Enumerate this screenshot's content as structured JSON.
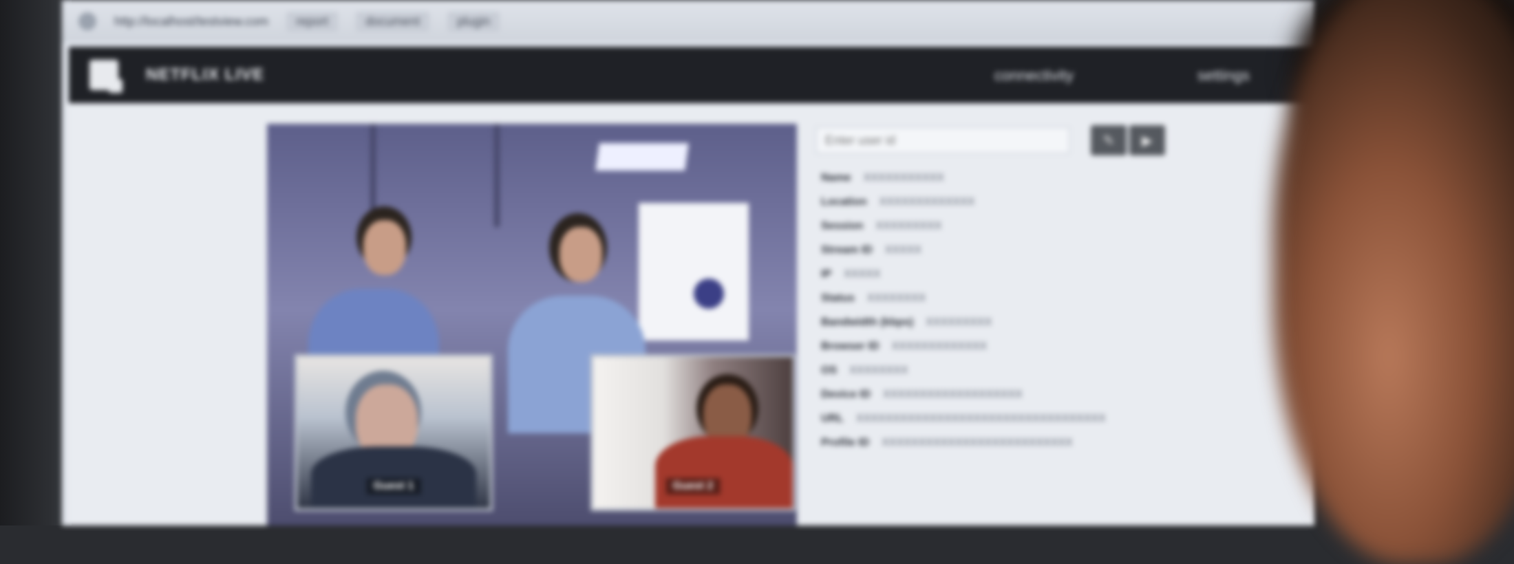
{
  "browser": {
    "url": "http://localhost/testview.com",
    "tabs": [
      "report",
      "document",
      "plugin"
    ]
  },
  "header": {
    "title": "NETFLIX LIVE",
    "links": [
      "connectivity",
      "settings"
    ]
  },
  "video": {
    "pip_labels": [
      "Guest 1",
      "Guest 2"
    ]
  },
  "panel": {
    "search_placeholder": "Enter user id",
    "buttons": [
      "edit-icon",
      "play-icon"
    ],
    "meta": [
      {
        "key": "Name",
        "value": "XXXXXXXXXXX"
      },
      {
        "key": "Location",
        "value": "XXXXXXXXXXXXX"
      },
      {
        "key": "Session",
        "value": "XXXXXXXXX"
      },
      {
        "key": "Stream ID",
        "value": "XXXXX"
      },
      {
        "key": "IP",
        "value": "XXXXX"
      },
      {
        "key": "Status",
        "value": "XXXXXXXX"
      },
      {
        "key": "Bandwidth (kbps)",
        "value": "XXXXXXXXX"
      },
      {
        "key": "Browser ID",
        "value": "XXXXXXXXXXXXX"
      },
      {
        "key": "OS",
        "value": "XXXXXXXX"
      },
      {
        "key": "Device ID",
        "value": "XXXXXXXXXXXXXXXXXXX"
      },
      {
        "key": "URL",
        "value": "XXXXXXXXXXXXXXXXXXXXXXXXXXXXXXXXXX"
      },
      {
        "key": "Profile ID",
        "value": "XXXXXXXXXXXXXXXXXXXXXXXXXX"
      }
    ]
  }
}
